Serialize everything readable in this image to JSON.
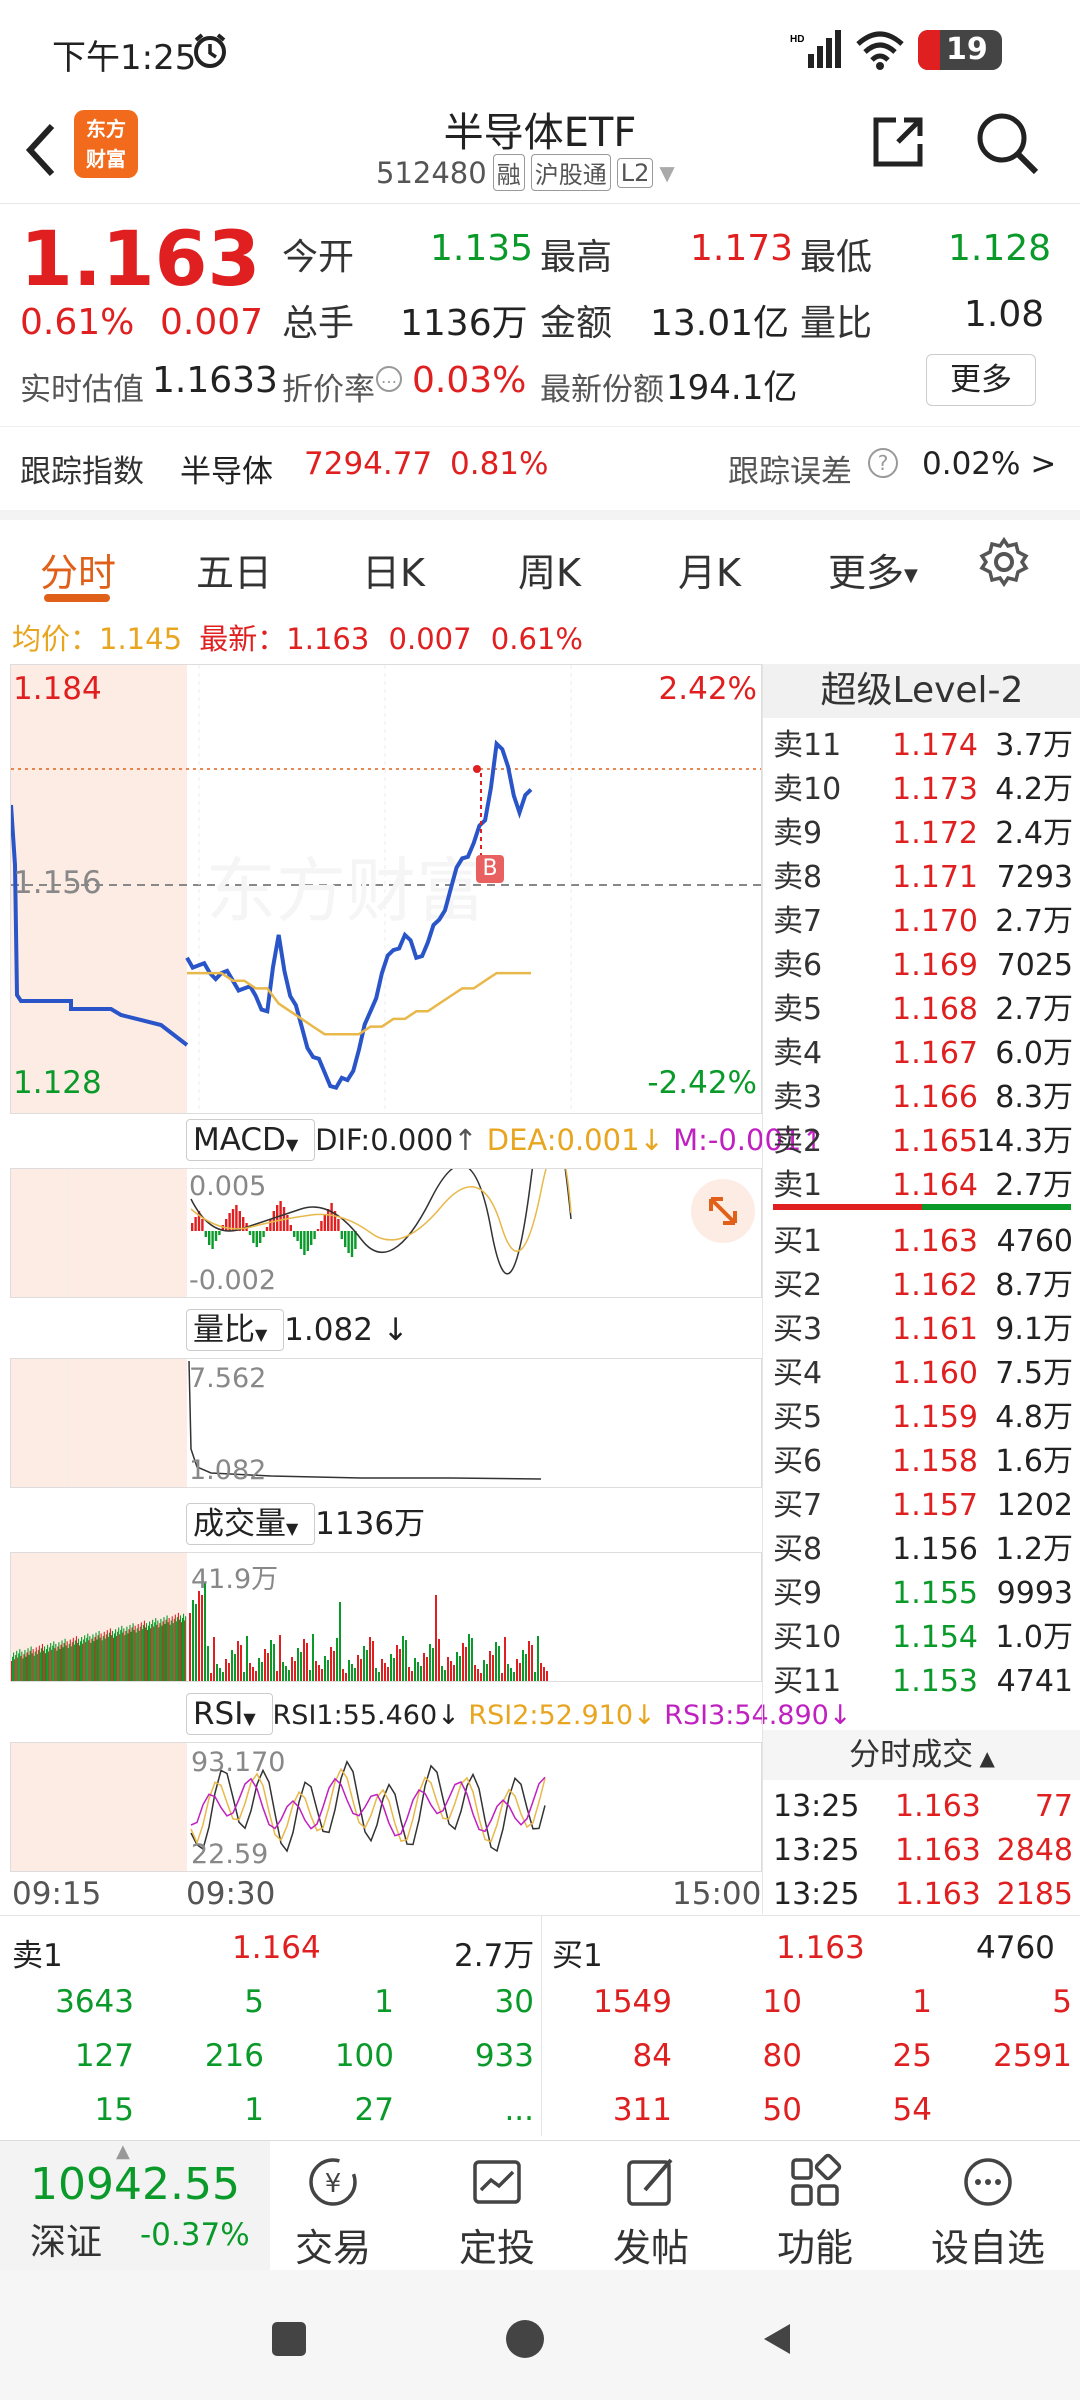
{
  "status": {
    "time": "下午1:25",
    "battery": "19"
  },
  "nav": {
    "title": "半导体ETF",
    "code": "512480",
    "tags": [
      "融",
      "沪股通",
      "L2"
    ],
    "logo_line1": "东方",
    "logo_line2": "财富"
  },
  "quote": {
    "price": "1.163",
    "pct": "0.61%",
    "chg": "0.007",
    "open_label": "今开",
    "open": "1.135",
    "high_label": "最高",
    "high": "1.173",
    "low_label": "最低",
    "low": "1.128",
    "vol_label": "总手",
    "vol": "1136万",
    "amt_label": "金额",
    "amt": "13.01亿",
    "ratio_label": "量比",
    "ratio": "1.08",
    "iopv_label": "实时估值",
    "iopv": "1.1633",
    "premium_label": "折价率",
    "premium": "0.03%",
    "shares_label": "最新份额",
    "shares": "194.1亿",
    "more": "更多",
    "track_label": "跟踪指数",
    "track_name": "半导体",
    "track_value": "7294.77",
    "track_pct": "0.81%",
    "err_label": "跟踪误差",
    "err_value": "0.02% >"
  },
  "tabs": [
    "分时",
    "五日",
    "日K",
    "周K",
    "月K",
    "更多"
  ],
  "avg_line": {
    "avg_label": "均价：",
    "avg": "1.145",
    "last_label": "最新：",
    "last": "1.163",
    "chg": "0.007",
    "pct": "0.61%"
  },
  "chart": {
    "top": "1.184",
    "mid": "1.156",
    "bottom": "1.128",
    "top_pct": "2.42%",
    "bottom_pct": "-2.42%",
    "buy_marker": "B",
    "watermark": "东方财富",
    "time_start": "09:15",
    "time_mid": "09:30",
    "time_end": "15:00"
  },
  "chart_data": {
    "type": "line",
    "title": "半导体ETF 分时",
    "ylim": [
      1.128,
      1.184
    ],
    "series": [
      {
        "name": "价格",
        "values": [
          1.147,
          1.146,
          1.145,
          1.145,
          1.144,
          1.143,
          1.142,
          1.14,
          1.15,
          1.142,
          1.138,
          1.134,
          1.132,
          1.13,
          1.131,
          1.135,
          1.14,
          1.145,
          1.148,
          1.15,
          1.147,
          1.149,
          1.152,
          1.156,
          1.16,
          1.162,
          1.165,
          1.175,
          1.172,
          1.166,
          1.169
        ]
      },
      {
        "name": "均价",
        "values": [
          1.145,
          1.145,
          1.145,
          1.145,
          1.144,
          1.144,
          1.143,
          1.143,
          1.141,
          1.14,
          1.139,
          1.138,
          1.137,
          1.137,
          1.137,
          1.137,
          1.138,
          1.138,
          1.139,
          1.139,
          1.14,
          1.14,
          1.141,
          1.142,
          1.143,
          1.143,
          1.144,
          1.145,
          1.145,
          1.145,
          1.145
        ]
      }
    ]
  },
  "macd": {
    "name": "MACD",
    "dif": "DIF:0.000",
    "dea": "DEA:0.001",
    "m": "M:-0.001",
    "top": "0.005",
    "bottom": "-0.002"
  },
  "vr": {
    "name": "量比",
    "value": "1.082",
    "top": "7.562",
    "bottom": "1.082"
  },
  "volume": {
    "name": "成交量",
    "value": "1136万",
    "top": "41.9万"
  },
  "rsi": {
    "name": "RSI",
    "rsi1": "RSI1:55.460",
    "rsi2": "RSI2:52.910",
    "rsi3": "RSI3:54.890",
    "top": "93.170",
    "bottom": "22.59"
  },
  "orderbook": {
    "title": "超级Level-2",
    "asks": [
      {
        "label": "卖11",
        "price": "1.174",
        "vol": "3.7万"
      },
      {
        "label": "卖10",
        "price": "1.173",
        "vol": "4.2万"
      },
      {
        "label": "卖9",
        "price": "1.172",
        "vol": "2.4万"
      },
      {
        "label": "卖8",
        "price": "1.171",
        "vol": "7293"
      },
      {
        "label": "卖7",
        "price": "1.170",
        "vol": "2.7万"
      },
      {
        "label": "卖6",
        "price": "1.169",
        "vol": "7025"
      },
      {
        "label": "卖5",
        "price": "1.168",
        "vol": "2.7万"
      },
      {
        "label": "卖4",
        "price": "1.167",
        "vol": "6.0万"
      },
      {
        "label": "卖3",
        "price": "1.166",
        "vol": "8.3万"
      },
      {
        "label": "卖2",
        "price": "1.165",
        "vol": "14.3万"
      },
      {
        "label": "卖1",
        "price": "1.164",
        "vol": "2.7万"
      }
    ],
    "bids": [
      {
        "label": "买1",
        "price": "1.163",
        "vol": "4760"
      },
      {
        "label": "买2",
        "price": "1.162",
        "vol": "8.7万"
      },
      {
        "label": "买3",
        "price": "1.161",
        "vol": "9.1万"
      },
      {
        "label": "买4",
        "price": "1.160",
        "vol": "7.5万"
      },
      {
        "label": "买5",
        "price": "1.159",
        "vol": "4.8万"
      },
      {
        "label": "买6",
        "price": "1.158",
        "vol": "1.6万"
      },
      {
        "label": "买7",
        "price": "1.157",
        "vol": "1202"
      },
      {
        "label": "买8",
        "price": "1.156",
        "vol": "1.2万"
      },
      {
        "label": "买9",
        "price": "1.155",
        "vol": "9993"
      },
      {
        "label": "买10",
        "price": "1.154",
        "vol": "1.0万"
      },
      {
        "label": "买11",
        "price": "1.153",
        "vol": "4741"
      }
    ],
    "trades_title": "分时成交",
    "trades": [
      {
        "time": "13:25",
        "price": "1.163",
        "vol": "77"
      },
      {
        "time": "13:25",
        "price": "1.163",
        "vol": "2848"
      },
      {
        "time": "13:25",
        "price": "1.163",
        "vol": "2185"
      }
    ]
  },
  "queue": {
    "ask_label": "卖1",
    "ask_price": "1.164",
    "ask_vol": "2.7万",
    "bid_label": "买1",
    "bid_price": "1.163",
    "bid_vol": "4760",
    "ask_cells": [
      "3643",
      "5",
      "1",
      "30",
      "127",
      "216",
      "100",
      "933",
      "15",
      "1",
      "27",
      "..."
    ],
    "bid_cells": [
      "1549",
      "10",
      "1",
      "5",
      "84",
      "80",
      "25",
      "2591",
      "311",
      "50",
      "54",
      ""
    ]
  },
  "bottom": {
    "index_value": "10942.55",
    "index_name": "深证",
    "index_pct": "-0.37%",
    "tabs": [
      "交易",
      "定投",
      "发帖",
      "功能",
      "设自选"
    ]
  },
  "colors": {
    "up": "#e02020",
    "down": "#0a9a2a",
    "accent": "#e0601a",
    "price_line": "#2a55c8",
    "avg_line": "#e8b84a"
  }
}
